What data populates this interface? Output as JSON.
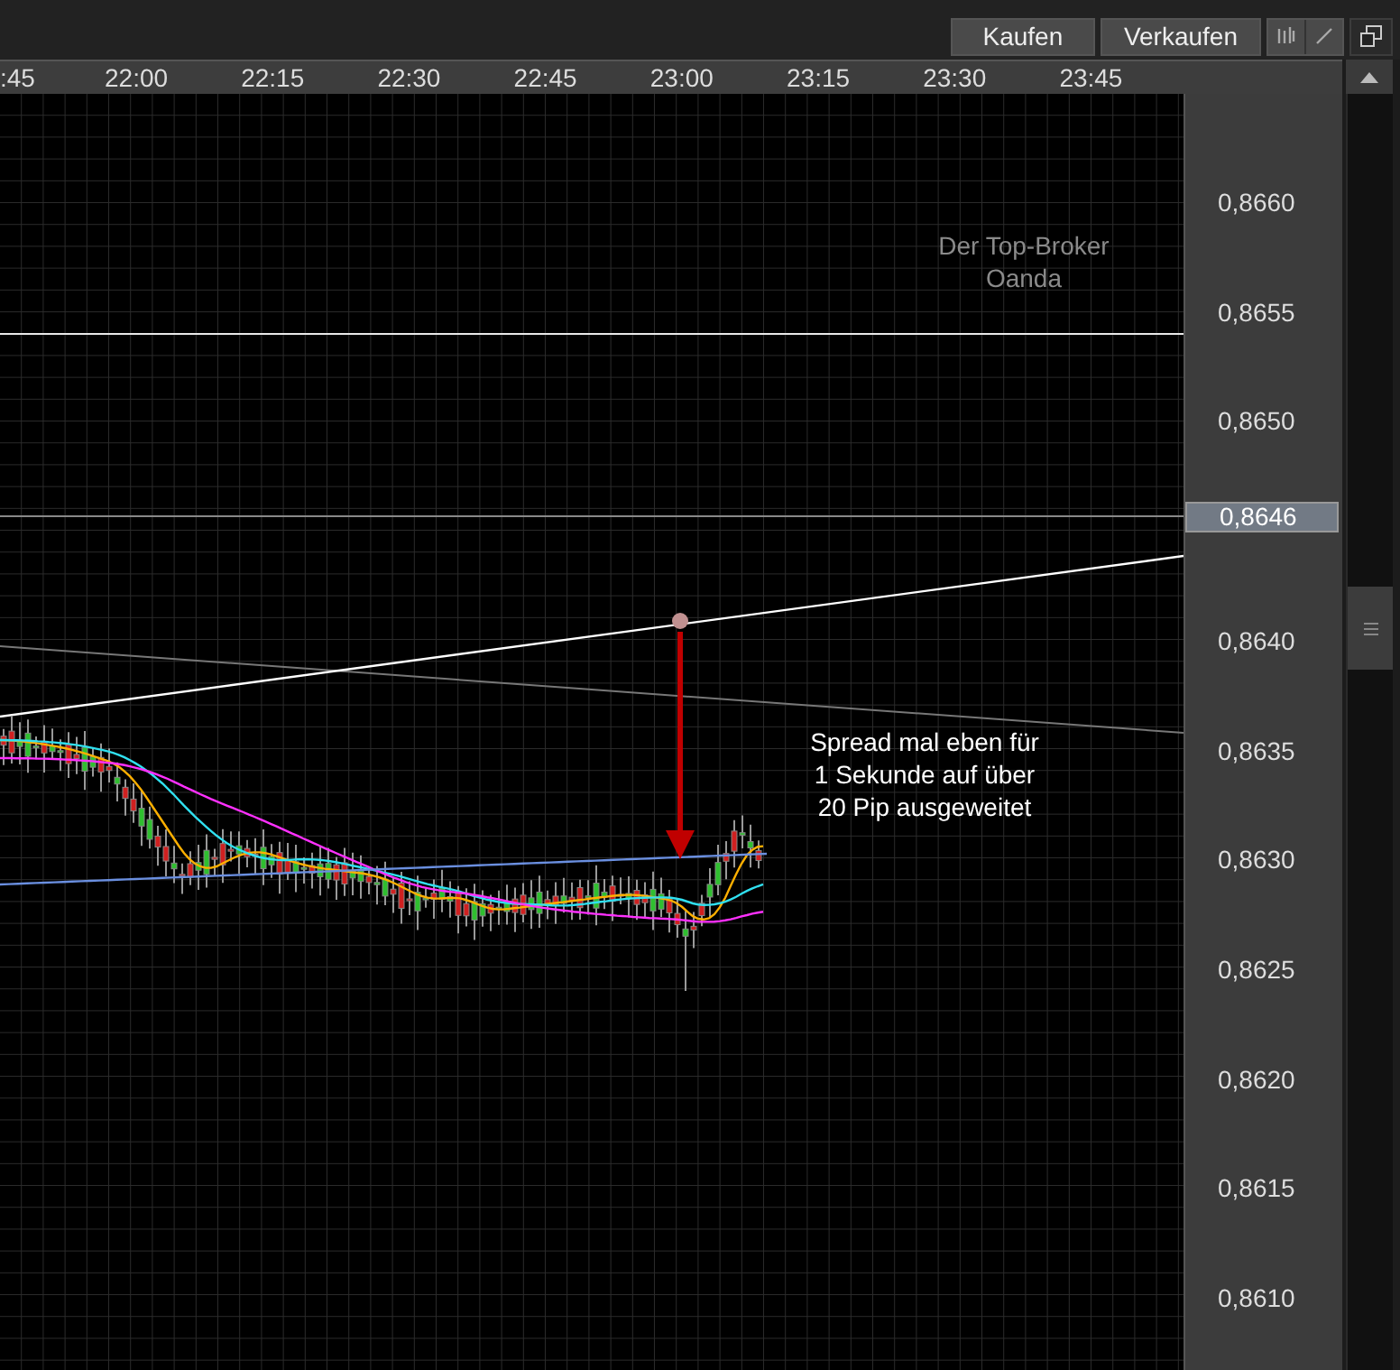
{
  "toolbar": {
    "buttons": [
      {
        "label": "Kaufen"
      },
      {
        "label": "Verkaufen"
      }
    ]
  },
  "time_axis": {
    "labels": [
      ":45",
      "22:00",
      "22:15",
      "22:30",
      "22:45",
      "23:00",
      "23:15",
      "23:30",
      "23:45"
    ]
  },
  "price_axis": {
    "labels": [
      "0,8660",
      "0,8655",
      "0,8650",
      "0,8640",
      "0,8635",
      "0,8630",
      "0,8625",
      "0,8620",
      "0,8615",
      "0,8610"
    ],
    "current_price": "0,8646"
  },
  "annotations": [
    {
      "kind": "watermark-note",
      "text": "Der Top-Broker\nOanda"
    },
    {
      "kind": "callout",
      "text": "Spread mal eben für\n1 Sekunde auf über\n20 Pip ausgeweitet"
    }
  ]
}
